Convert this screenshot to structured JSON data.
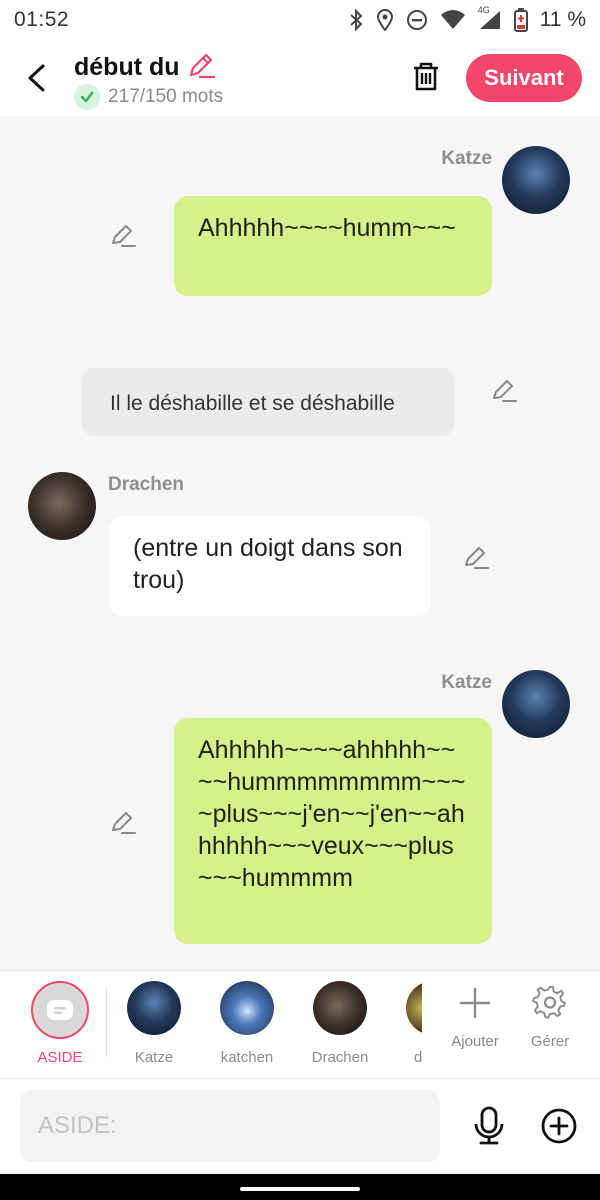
{
  "status_bar": {
    "time": "01:52",
    "network": "4G",
    "battery": "11 %"
  },
  "header": {
    "title": "début du",
    "word_count": "217/150 mots",
    "next_label": "Suivant",
    "accent_color": "#f2456a"
  },
  "messages": [
    {
      "type": "character",
      "side": "right",
      "name": "Katze",
      "text": "Ahhhhh~~~~humm~~~",
      "bubble_color": "#d6f18a"
    },
    {
      "type": "aside",
      "text": "Il le déshabille et se déshabille"
    },
    {
      "type": "character",
      "side": "left",
      "name": "Drachen",
      "text": "(entre un doigt dans son trou)",
      "bubble_color": "#ffffff"
    },
    {
      "type": "character",
      "side": "right",
      "name": "Katze",
      "text": "Ahhhhh~~~~ahhhhh~~~~hummmmmmmm~~~~plus~~~j'en~~j'en~~ahhhhhh~~~veux~~~plus~~~hummmm",
      "bubble_color": "#d6f18a"
    }
  ],
  "characters": [
    {
      "label": "ASIDE",
      "selected": true
    },
    {
      "label": "Katze"
    },
    {
      "label": "katchen"
    },
    {
      "label": "Drachen"
    },
    {
      "label": "d"
    }
  ],
  "tools": [
    {
      "label": "Ajouter",
      "icon": "plus-icon"
    },
    {
      "label": "Gérer",
      "icon": "gear-icon"
    }
  ],
  "input": {
    "placeholder": "ASIDE:"
  }
}
